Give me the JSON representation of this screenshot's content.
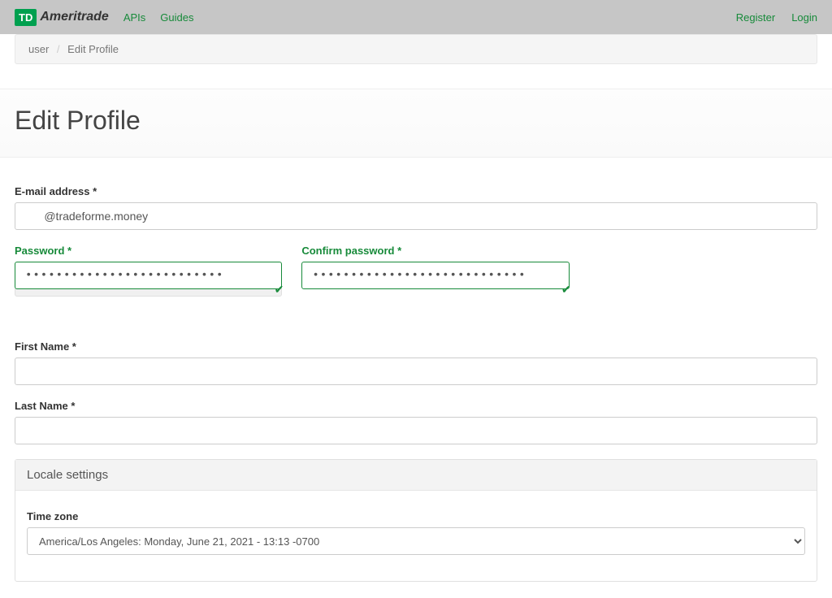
{
  "nav": {
    "logo": {
      "badge": "TD",
      "text": "Ameritrade"
    },
    "links": {
      "apis": "APIs",
      "guides": "Guides",
      "register": "Register",
      "login": "Login"
    }
  },
  "breadcrumb": {
    "parent": "user",
    "current": "Edit Profile"
  },
  "page": {
    "title": "Edit Profile"
  },
  "form": {
    "email": {
      "label": "E-mail address *",
      "value": "      @tradeforme.money"
    },
    "password": {
      "label": "Password *",
      "value": "••••••••••••••••••••••••••"
    },
    "confirm_password": {
      "label": "Confirm password *",
      "value": "••••••••••••••••••••••••••••"
    },
    "first_name": {
      "label": "First Name *",
      "value": ""
    },
    "last_name": {
      "label": "Last Name *",
      "value": ""
    }
  },
  "locale": {
    "panel_title": "Locale settings",
    "timezone_label": "Time zone",
    "timezone_value": "America/Los Angeles: Monday, June 21, 2021 - 13:13 -0700"
  }
}
